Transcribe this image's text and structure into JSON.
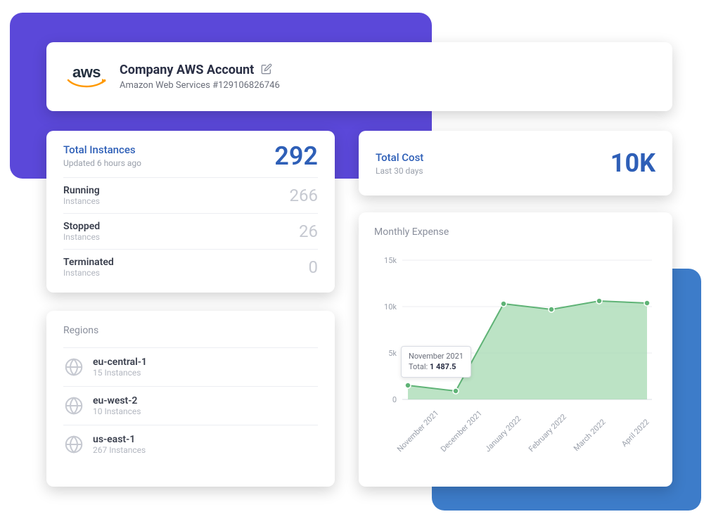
{
  "account": {
    "logo_text": "aws",
    "title": "Company AWS Account",
    "subtitle": "Amazon Web Services #129106826746"
  },
  "instances": {
    "title": "Total Instances",
    "updated": "Updated 6 hours ago",
    "total": "292",
    "rows": [
      {
        "name": "Running",
        "sub": "Instances",
        "value": "266"
      },
      {
        "name": "Stopped",
        "sub": "Instances",
        "value": "26"
      },
      {
        "name": "Terminated",
        "sub": "Instances",
        "value": "0"
      }
    ]
  },
  "cost": {
    "title": "Total Cost",
    "sub": "Last 30 days",
    "value": "10K"
  },
  "chart": {
    "title": "Monthly Expense",
    "tooltip_label": "November 2021",
    "tooltip_prefix": "Total: ",
    "tooltip_value": "1 487.5",
    "ytick0": "0",
    "ytick1": "5k",
    "ytick2": "10k",
    "ytick3": "15k",
    "x0": "November 2021",
    "x1": "December 2021",
    "x2": "January 2022",
    "x3": "February 2022",
    "x4": "March 2022",
    "x5": "April 2022"
  },
  "chart_data": {
    "type": "area",
    "title": "Monthly Expense",
    "xlabel": "",
    "ylabel": "",
    "ylim": [
      0,
      15000
    ],
    "categories": [
      "November 2021",
      "December 2021",
      "January 2022",
      "February 2022",
      "March 2022",
      "April 2022"
    ],
    "values": [
      1487.5,
      900,
      10300,
      9700,
      10600,
      10400
    ],
    "tooltip": {
      "label": "November 2021",
      "total": 1487.5
    }
  },
  "regions": {
    "title": "Regions",
    "items": [
      {
        "name": "eu-central-1",
        "sub": "15 Instances"
      },
      {
        "name": "eu-west-2",
        "sub": "10 Instances"
      },
      {
        "name": "us-east-1",
        "sub": "267 Instances"
      }
    ]
  }
}
